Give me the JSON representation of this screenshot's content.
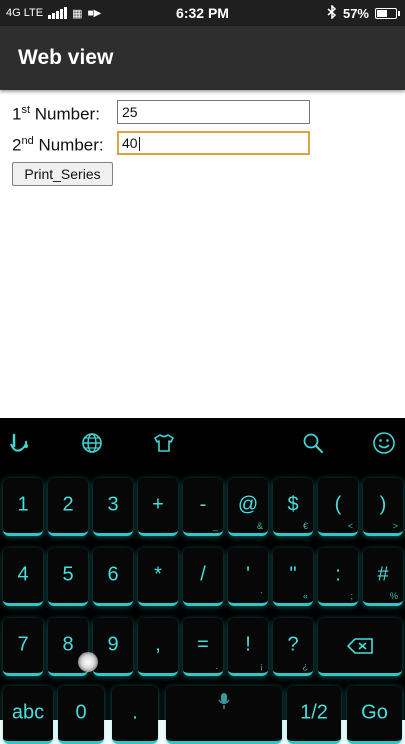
{
  "status_bar": {
    "network": "4G LTE",
    "time": "6:32 PM",
    "battery_percent": "57%",
    "battery_level": 0.57
  },
  "app_bar": {
    "title": "Web view"
  },
  "form": {
    "first": {
      "label_prefix": "1",
      "label_sup": "st",
      "label_rest": " Number:",
      "value": "25"
    },
    "second": {
      "label_prefix": "2",
      "label_sup": "nd",
      "label_rest": " Number:",
      "value": "40"
    },
    "button_label": "Print_Series"
  },
  "keyboard": {
    "toolbar": [
      "swype-icon",
      "globe-icon",
      "tshirt-icon",
      "search-icon",
      "emoji-icon"
    ],
    "rows": [
      [
        {
          "k": "1"
        },
        {
          "k": "2"
        },
        {
          "k": "3"
        },
        {
          "k": "+"
        },
        {
          "k": "-",
          "s": "_"
        },
        {
          "k": "@",
          "s": "&"
        },
        {
          "k": "$",
          "s": "€"
        },
        {
          "k": "(",
          "s": "<"
        },
        {
          "k": ")",
          "s": ">"
        }
      ],
      [
        {
          "k": "4"
        },
        {
          "k": "5"
        },
        {
          "k": "6"
        },
        {
          "k": "*"
        },
        {
          "k": "/"
        },
        {
          "k": "'",
          "s": "`"
        },
        {
          "k": "\"",
          "s": "«"
        },
        {
          "k": ":",
          "s": ";"
        },
        {
          "k": "#",
          "s": "%"
        }
      ],
      [
        {
          "k": "7"
        },
        {
          "k": "8"
        },
        {
          "k": "9"
        },
        {
          "k": ","
        },
        {
          "k": "=",
          "s": "."
        },
        {
          "k": "!",
          "s": "¡"
        },
        {
          "k": "?",
          "s": "¿"
        },
        {
          "k": "backspace"
        }
      ],
      [
        {
          "k": "abc"
        },
        {
          "k": "0"
        },
        {
          "k": "."
        },
        {
          "k": "space"
        },
        {
          "k": "1/2"
        },
        {
          "k": "Go"
        }
      ]
    ]
  }
}
